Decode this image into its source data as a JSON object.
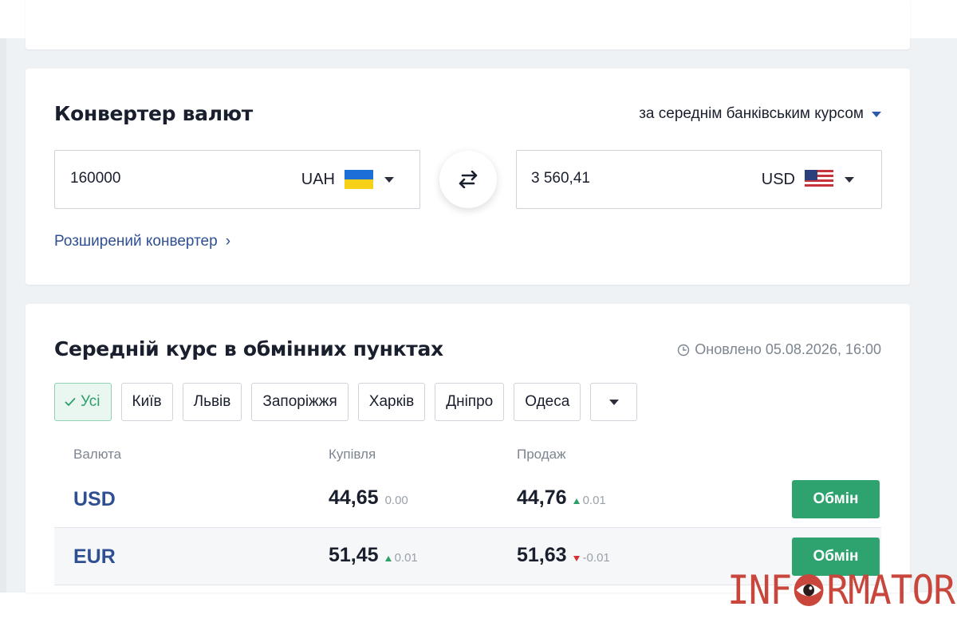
{
  "converter": {
    "title": "Конвертер валют",
    "rate_mode": "за середнім банківським курсом",
    "from": {
      "value": "160000",
      "currency": "UAH"
    },
    "to": {
      "value": "3 560,41",
      "currency": "USD"
    },
    "advanced_link": "Розширений конвертер",
    "advanced_arrow": "›"
  },
  "rates": {
    "title": "Середній курс в обмінних пунктах",
    "updated": "Оновлено 05.08.2026, 16:00",
    "filters": [
      "Усі",
      "Київ",
      "Львів",
      "Запоріжжя",
      "Харків",
      "Дніпро",
      "Одеса"
    ],
    "active_filter": "Усі",
    "columns": {
      "currency": "Валюта",
      "buy": "Купівля",
      "sell": "Продаж"
    },
    "rows": [
      {
        "currency": "USD",
        "buy": "44,65",
        "buy_change": "0.00",
        "buy_trend": "none",
        "sell": "44,76",
        "sell_change": "0.01",
        "sell_trend": "up",
        "action": "Обмін"
      },
      {
        "currency": "EUR",
        "buy": "51,45",
        "buy_change": "0.01",
        "buy_trend": "up",
        "sell": "51,63",
        "sell_change": "-0.01",
        "sell_trend": "down",
        "action": "Обмін"
      }
    ]
  },
  "watermark": {
    "text_left": "INF",
    "text_right": "RMATOR"
  },
  "colors": {
    "accent_blue": "#2e4f92",
    "green": "#2fa36f",
    "red": "#d63031",
    "logo_red": "#c8463c"
  }
}
